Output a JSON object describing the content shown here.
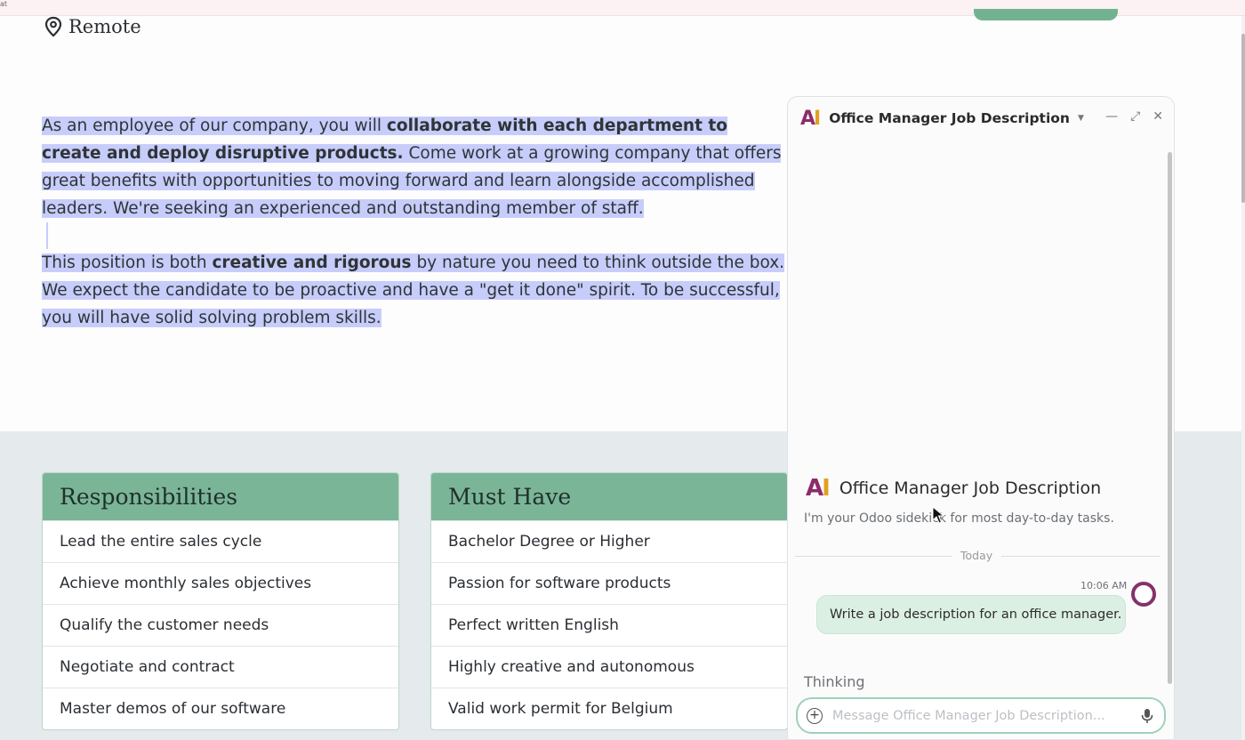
{
  "top_strip": {
    "label": "at"
  },
  "location": {
    "label": "Remote"
  },
  "description": {
    "p1_a": "As an employee of our company, you will ",
    "p1_b": "collaborate with each department to create and deploy disruptive products.",
    "p1_c": " Come work at a growing company that offers great benefits with opportunities to moving forward and learn alongside accomplished leaders. We're seeking an experienced and outstanding member of staff.",
    "p2_a": "This position is both ",
    "p2_b": "creative and rigorous",
    "p2_c": " by nature you need to think outside the box. We expect the candidate to be proactive and have a \"get it done\" spirit. To be successful, you will have solid solving problem skills."
  },
  "responsibilities": {
    "title": "Responsibilities",
    "items": [
      "Lead the entire sales cycle",
      "Achieve monthly sales objectives",
      "Qualify the customer needs",
      "Negotiate and contract",
      "Master demos of our software"
    ]
  },
  "must_have": {
    "title": "Must Have",
    "items": [
      "Bachelor Degree or Higher",
      "Passion for software products",
      "Perfect written English",
      "Highly creative and autonomous",
      "Valid work permit for Belgium"
    ]
  },
  "chat": {
    "logo": "AI",
    "title": "Office Manager Job Description",
    "intro_title": "Office Manager Job Description",
    "intro_sub": "I'm your Odoo sidekick for most day-to-day tasks.",
    "day_separator": "Today",
    "message_time": "10:06 AM",
    "message_text": "Write a job description for an office manager.",
    "status": "Thinking",
    "composer_placeholder": "Message Office Manager Job Description..."
  },
  "colors": {
    "card_header": "#7bb598",
    "selection": "#c7cdfa",
    "chat_bubble": "#dbf0e3",
    "avatar_ring": "#85316b",
    "composer_border": "#9fd1b8"
  },
  "icons": [
    "map-pin-icon",
    "ai-logo-icon",
    "chevron-down-icon",
    "minimize-icon",
    "expand-icon",
    "close-icon",
    "add-icon",
    "microphone-icon",
    "cursor-icon"
  ]
}
